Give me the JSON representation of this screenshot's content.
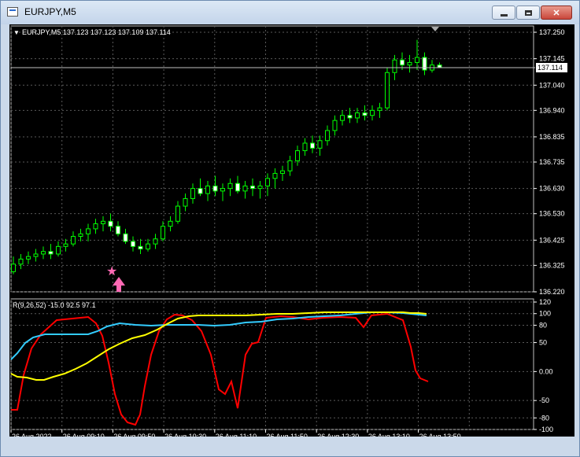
{
  "window": {
    "title": "EURJPY,M5"
  },
  "chart": {
    "header": "EURJPY,M5  137.123 137.123 137.109 137.114",
    "bid_tag": "137.114",
    "price_ticks": [
      "137.250",
      "137.145",
      "137.040",
      "136.940",
      "136.835",
      "136.735",
      "136.630",
      "136.530",
      "136.425",
      "136.325",
      "136.220"
    ],
    "indicator": {
      "label": "R(9,26,52) -15.0 92.5 97.1",
      "ticks": [
        "120",
        "100",
        "80",
        "50",
        "0.00",
        "-50",
        "-80",
        "-100"
      ]
    },
    "time_labels": [
      "26 Aug 2022",
      "26 Aug 09:10",
      "26 Aug 09:50",
      "26 Aug 10:30",
      "26 Aug 11:10",
      "26 Aug 11:50",
      "26 Aug 12:30",
      "26 Aug 13:10",
      "26 Aug 13:50"
    ]
  },
  "chart_data": {
    "type": "candlestick",
    "symbol": "EURJPY",
    "timeframe": "M5",
    "ylim": [
      136.22,
      137.25
    ],
    "candles": [
      [
        136.3,
        136.36,
        136.29,
        136.33
      ],
      [
        136.33,
        136.37,
        136.31,
        136.35
      ],
      [
        136.35,
        136.38,
        136.33,
        136.36
      ],
      [
        136.36,
        136.39,
        136.34,
        136.37
      ],
      [
        136.37,
        136.4,
        136.35,
        136.38
      ],
      [
        136.38,
        136.41,
        136.35,
        136.37
      ],
      [
        136.37,
        136.42,
        136.36,
        136.4
      ],
      [
        136.4,
        136.43,
        136.38,
        136.41
      ],
      [
        136.41,
        136.46,
        136.4,
        136.44
      ],
      [
        136.44,
        136.47,
        136.42,
        136.45
      ],
      [
        136.45,
        136.49,
        136.42,
        136.47
      ],
      [
        136.47,
        136.51,
        136.45,
        136.49
      ],
      [
        136.49,
        136.52,
        136.46,
        136.5
      ],
      [
        136.5,
        136.53,
        136.46,
        136.48
      ],
      [
        136.48,
        136.5,
        136.44,
        136.45
      ],
      [
        136.45,
        136.47,
        136.41,
        136.42
      ],
      [
        136.42,
        136.44,
        136.38,
        136.4
      ],
      [
        136.4,
        136.43,
        136.37,
        136.39
      ],
      [
        136.39,
        136.43,
        136.38,
        136.41
      ],
      [
        136.41,
        136.45,
        136.39,
        136.43
      ],
      [
        136.43,
        136.5,
        136.42,
        136.48
      ],
      [
        136.48,
        136.52,
        136.46,
        136.5
      ],
      [
        136.5,
        136.58,
        136.49,
        136.56
      ],
      [
        136.56,
        136.61,
        136.54,
        136.59
      ],
      [
        136.59,
        136.65,
        136.57,
        136.63
      ],
      [
        136.63,
        136.67,
        136.6,
        136.61
      ],
      [
        136.61,
        136.66,
        136.58,
        136.64
      ],
      [
        136.64,
        136.68,
        136.6,
        136.62
      ],
      [
        136.62,
        136.65,
        136.58,
        136.63
      ],
      [
        136.63,
        136.67,
        136.6,
        136.65
      ],
      [
        136.65,
        136.68,
        136.61,
        136.62
      ],
      [
        136.62,
        136.66,
        136.59,
        136.64
      ],
      [
        136.64,
        136.67,
        136.6,
        136.63
      ],
      [
        136.63,
        136.66,
        136.59,
        136.64
      ],
      [
        136.64,
        136.69,
        136.6,
        136.67
      ],
      [
        136.67,
        136.71,
        136.63,
        136.69
      ],
      [
        136.69,
        136.72,
        136.66,
        136.7
      ],
      [
        136.7,
        136.76,
        136.68,
        136.74
      ],
      [
        136.74,
        136.8,
        136.72,
        136.78
      ],
      [
        136.78,
        136.83,
        136.76,
        136.81
      ],
      [
        136.81,
        136.84,
        136.77,
        136.79
      ],
      [
        136.79,
        136.84,
        136.76,
        136.82
      ],
      [
        136.82,
        136.88,
        136.8,
        136.86
      ],
      [
        136.86,
        136.92,
        136.84,
        136.9
      ],
      [
        136.9,
        136.94,
        136.88,
        136.92
      ],
      [
        136.92,
        136.95,
        136.89,
        136.91
      ],
      [
        136.91,
        136.95,
        136.89,
        136.93
      ],
      [
        136.93,
        136.96,
        136.9,
        136.92
      ],
      [
        136.92,
        136.96,
        136.9,
        136.94
      ],
      [
        136.94,
        136.97,
        136.91,
        136.95
      ],
      [
        136.95,
        137.11,
        136.94,
        137.09
      ],
      [
        137.09,
        137.16,
        137.06,
        137.14
      ],
      [
        137.14,
        137.17,
        137.1,
        137.12
      ],
      [
        137.12,
        137.16,
        137.09,
        137.13
      ],
      [
        137.13,
        137.22,
        137.1,
        137.15
      ],
      [
        137.15,
        137.17,
        137.08,
        137.1
      ],
      [
        137.1,
        137.14,
        137.09,
        137.12
      ],
      [
        137.12,
        137.13,
        137.11,
        137.11
      ]
    ],
    "arrow_signal": {
      "type": "buy",
      "at_index": 17
    },
    "indicator": {
      "name": "R(9,26,52)",
      "ylim": [
        -100,
        120
      ],
      "values": {
        "red": -15.0,
        "cyan": 92.5,
        "yellow": 97.1
      }
    },
    "colors": {
      "bull": "#00ff00",
      "bear_body": "#ffffff",
      "red": "#ff0000",
      "cyan": "#33ccff",
      "yellow": "#ffff00",
      "arrow": "#ff69b4"
    }
  }
}
